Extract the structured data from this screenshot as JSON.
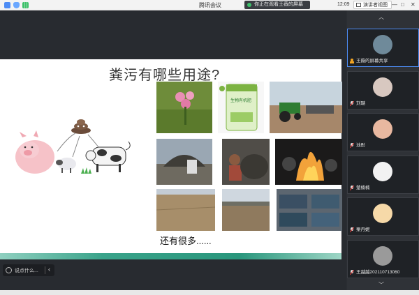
{
  "app": {
    "title": "腾讯会议"
  },
  "topbar": {
    "watching_text": "你正在观看王薇的屏幕",
    "time": "12:09",
    "view_button": "演讲者视图",
    "controls": [
      "—",
      "□",
      "✕"
    ]
  },
  "slide": {
    "title": "粪污有哪些用途?",
    "footer": "还有很多......",
    "bag_label": "生物有机肥"
  },
  "participants": [
    {
      "name": "王薇的屏幕共享",
      "active": true,
      "avatar_color": "#6f8a9a"
    },
    {
      "name": "刘璐",
      "active": false,
      "avatar_color": "#d8c8c0"
    },
    {
      "name": "池彤",
      "active": false,
      "avatar_color": "#e8b8a0"
    },
    {
      "name": "楚楠楠",
      "active": false,
      "avatar_color": "#f2f2f2"
    },
    {
      "name": "栗丹妮",
      "active": false,
      "avatar_color": "#f6d9a8"
    },
    {
      "name": "王越越2021107130​60",
      "active": false,
      "avatar_color": "#9a9a9a"
    }
  ],
  "chat": {
    "placeholder": "说点什么..."
  },
  "colors": {
    "accent": "#4d8cf5",
    "green_band": "#29967c",
    "watch_dot": "#3ec16a"
  }
}
